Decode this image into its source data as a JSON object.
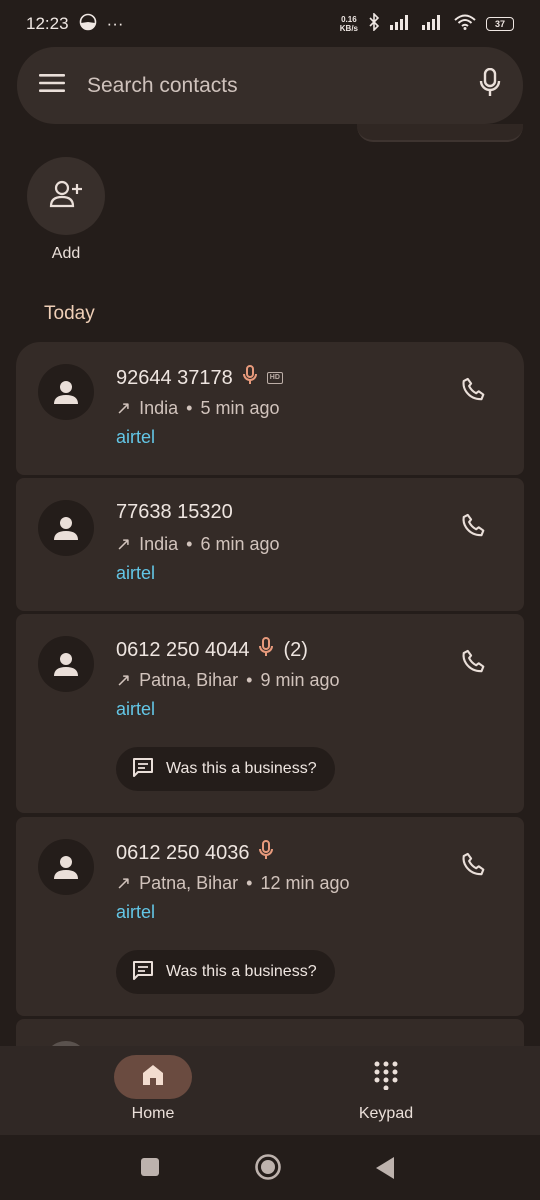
{
  "status_bar": {
    "time": "12:23",
    "overflow": "···",
    "net_speed_value": "0.16",
    "net_speed_unit": "KB/s",
    "battery": "37"
  },
  "search": {
    "placeholder": "Search contacts",
    "menu_icon": "menu-icon",
    "mic_icon": "mic-icon"
  },
  "add_contact": {
    "label": "Add",
    "icon": "person-add-icon"
  },
  "section": {
    "title": "Today"
  },
  "calls": [
    {
      "number": "92644 37178",
      "recorded": true,
      "hd": true,
      "hd_label": "HD",
      "count": "",
      "direction": "↗",
      "location": "India",
      "time": "5 min ago",
      "carrier": "airtel",
      "business_prompt": ""
    },
    {
      "number": "77638 15320",
      "recorded": false,
      "hd": false,
      "count": "",
      "direction": "↗",
      "location": "India",
      "time": "6 min ago",
      "carrier": "airtel",
      "business_prompt": ""
    },
    {
      "number": "0612 250 4044",
      "recorded": true,
      "hd": false,
      "count": "(2)",
      "direction": "↗",
      "location": "Patna, Bihar",
      "time": "9 min ago",
      "carrier": "airtel",
      "business_prompt": "Was this a business?"
    },
    {
      "number": "0612 250 4036",
      "recorded": true,
      "hd": false,
      "count": "",
      "direction": "↗",
      "location": "Patna, Bihar",
      "time": "12 min ago",
      "carrier": "airtel",
      "business_prompt": "Was this a business?"
    }
  ],
  "bottom_nav": {
    "home": {
      "label": "Home",
      "icon": "home-icon",
      "active": true
    },
    "keypad": {
      "label": "Keypad",
      "icon": "dialpad-icon",
      "active": false
    }
  },
  "colors": {
    "background": "#241d1a",
    "card": "#342b27",
    "accent": "#efcfb7",
    "carrier": "#63c6e6",
    "mic": "#e79a7c",
    "active_pill": "#6a4b40"
  }
}
